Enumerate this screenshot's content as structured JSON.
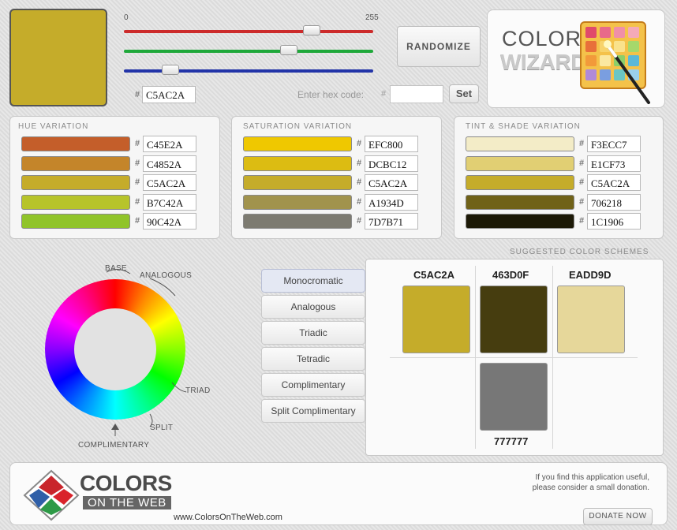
{
  "current_color": "#C5AC2A",
  "sliders": {
    "min_label": "0",
    "max_label": "255",
    "red": 197,
    "green": 172,
    "blue": 42,
    "red_color": "#cc2b2b",
    "green_color": "#1fa83a",
    "blue_color": "#2234a8"
  },
  "hex_input": {
    "hash": "#",
    "value": "C5AC2A"
  },
  "enter_hex": {
    "label": "Enter hex code:",
    "hash": "#",
    "value": "",
    "set_label": "Set"
  },
  "randomize_label": "RANDOMIZE",
  "logo": {
    "line1": "COLOR",
    "line2": "WIZARD"
  },
  "hue_variation": {
    "title": "HUE VARIATION",
    "items": [
      {
        "color": "#C45E2A",
        "hex": "C45E2A"
      },
      {
        "color": "#C4852A",
        "hex": "C4852A"
      },
      {
        "color": "#C5AC2A",
        "hex": "C5AC2A"
      },
      {
        "color": "#B7C42A",
        "hex": "B7C42A"
      },
      {
        "color": "#90C42A",
        "hex": "90C42A"
      }
    ]
  },
  "saturation_variation": {
    "title": "SATURATION VARIATION",
    "items": [
      {
        "color": "#EFC800",
        "hex": "EFC800"
      },
      {
        "color": "#DCBC12",
        "hex": "DCBC12"
      },
      {
        "color": "#C5AC2A",
        "hex": "C5AC2A"
      },
      {
        "color": "#A1934D",
        "hex": "A1934D"
      },
      {
        "color": "#7D7B71",
        "hex": "7D7B71"
      }
    ]
  },
  "tint_shade_variation": {
    "title": "TINT & SHADE VARIATION",
    "items": [
      {
        "color": "#F3ECC7",
        "hex": "F3ECC7"
      },
      {
        "color": "#E1CF73",
        "hex": "E1CF73"
      },
      {
        "color": "#C5AC2A",
        "hex": "C5AC2A"
      },
      {
        "color": "#706218",
        "hex": "706218"
      },
      {
        "color": "#1C1906",
        "hex": "1C1906"
      }
    ]
  },
  "wheel": {
    "labels": {
      "base": "BASE",
      "analogous": "ANALOGOUS",
      "triad": "TRIAD",
      "split": "SPLIT",
      "complimentary": "COMPLIMENTARY"
    }
  },
  "scheme_buttons": [
    "Monocromatic",
    "Analogous",
    "Triadic",
    "Tetradic",
    "Complimentary",
    "Split Complimentary"
  ],
  "suggested": {
    "title": "SUGGESTED COLOR SCHEMES",
    "swatches": [
      {
        "hex": "C5AC2A",
        "color": "#C5AC2A"
      },
      {
        "hex": "463D0F",
        "color": "#463D0F"
      },
      {
        "hex": "EADD9D",
        "color": "#E6D79A"
      },
      {
        "hex": "777777",
        "color": "#777777"
      }
    ]
  },
  "footer": {
    "brand_line1": "COLORS",
    "brand_line2": "ON THE WEB",
    "url": "www.ColorsOnTheWeb.com",
    "message_line1": "If you find this application useful,",
    "message_line2": "please consider a small donation.",
    "donate_label": "DONATE NOW"
  }
}
